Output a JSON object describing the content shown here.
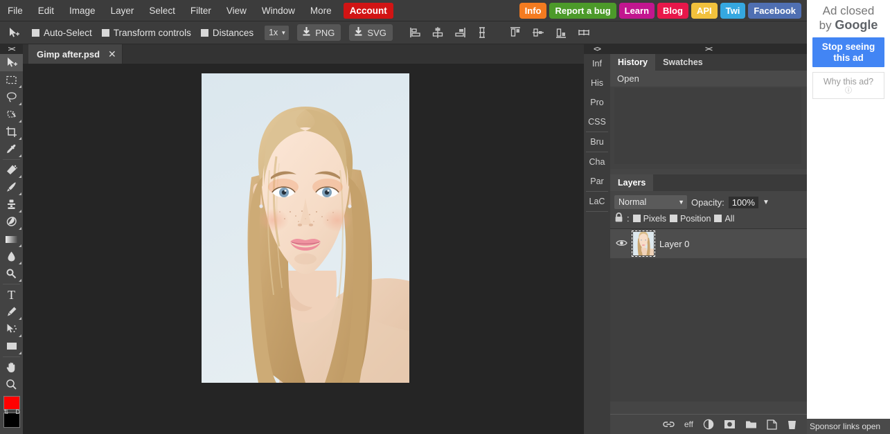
{
  "menubar": {
    "items": [
      "File",
      "Edit",
      "Image",
      "Layer",
      "Select",
      "Filter",
      "View",
      "Window",
      "More"
    ],
    "account_label": "Account",
    "right_buttons": [
      {
        "label": "Info",
        "color": "#f47b20"
      },
      {
        "label": "Report a bug",
        "color": "#4c9a2a"
      },
      {
        "label": "Learn",
        "color": "#c2168f"
      },
      {
        "label": "Blog",
        "color": "#e8174a"
      },
      {
        "label": "API",
        "color": "#f2c13c"
      },
      {
        "label": "Twi",
        "color": "#35a8e0"
      },
      {
        "label": "Facebook",
        "color": "#4f6fb2"
      }
    ]
  },
  "optionsbar": {
    "tool_icon": "move-tool-icon",
    "checkboxes": [
      {
        "label": "Auto-Select",
        "checked": false
      },
      {
        "label": "Transform controls",
        "checked": false
      },
      {
        "label": "Distances",
        "checked": false
      }
    ],
    "zoom_value": "1x",
    "download_buttons": [
      {
        "label": "PNG",
        "icon": "download-icon"
      },
      {
        "label": "SVG",
        "icon": "download-icon"
      }
    ],
    "align_icons_group1": [
      "align-left-icon",
      "align-center-horizontal-icon",
      "align-right-icon",
      "distribute-vertical-icon"
    ],
    "align_icons_group2": [
      "align-top-icon",
      "align-middle-vertical-icon",
      "align-bottom-icon",
      "distribute-horizontal-icon"
    ]
  },
  "toolbar": {
    "grip_label": "><",
    "tools": [
      {
        "name": "move-tool",
        "icon": "cursor-plus-icon",
        "active": true,
        "corner": false
      },
      {
        "name": "rectangular-marquee-tool",
        "icon": "marquee-rect-icon",
        "active": false,
        "corner": true
      },
      {
        "name": "lasso-tool",
        "icon": "lasso-icon",
        "active": false,
        "corner": true
      },
      {
        "name": "magic-wand-tool",
        "icon": "magic-wand-icon",
        "active": false,
        "corner": true
      },
      {
        "name": "crop-tool",
        "icon": "crop-icon",
        "active": false,
        "corner": true
      },
      {
        "name": "eyedropper-tool",
        "icon": "eyedropper-icon",
        "active": false,
        "corner": true
      },
      {
        "name": "healing-brush-tool",
        "icon": "healing-brush-icon",
        "active": false,
        "corner": true
      },
      {
        "name": "brush-tool",
        "icon": "brush-icon",
        "active": false,
        "corner": true
      },
      {
        "name": "clone-stamp-tool",
        "icon": "clone-stamp-icon",
        "active": false,
        "corner": true
      },
      {
        "name": "eraser-tool",
        "icon": "eraser-icon",
        "active": false,
        "corner": true
      },
      {
        "name": "gradient-tool",
        "icon": "gradient-icon",
        "active": false,
        "corner": true
      },
      {
        "name": "blur-tool",
        "icon": "blur-drop-icon",
        "active": false,
        "corner": true
      },
      {
        "name": "dodge-tool",
        "icon": "dodge-icon",
        "active": false,
        "corner": true
      },
      {
        "name": "type-tool",
        "icon": "text-t-icon",
        "active": false,
        "corner": false
      },
      {
        "name": "pen-tool",
        "icon": "pen-icon",
        "active": false,
        "corner": true
      },
      {
        "name": "path-select-tool",
        "icon": "path-select-icon",
        "active": false,
        "corner": true
      },
      {
        "name": "shape-tool",
        "icon": "rectangle-shape-icon",
        "active": false,
        "corner": true
      },
      {
        "name": "hand-tool",
        "icon": "hand-icon",
        "active": false,
        "corner": false
      },
      {
        "name": "zoom-tool",
        "icon": "magnifier-icon",
        "active": false,
        "corner": false
      }
    ],
    "foreground_color": "#ff0000",
    "background_color": "#000000",
    "swap_label": "⇅",
    "default_label": "D"
  },
  "document": {
    "tab_title": "Gimp after.psd",
    "close_label": "✕"
  },
  "panels": {
    "vertical_strip": {
      "grip_label": "<>",
      "tabs": [
        {
          "label": "Inf",
          "group": 1
        },
        {
          "label": "His",
          "group": 1
        },
        {
          "label": "Pro",
          "group": 1
        },
        {
          "label": "CSS",
          "group": 1
        },
        {
          "label": "Bru",
          "group": 2
        },
        {
          "label": "Cha",
          "group": 3
        },
        {
          "label": "Par",
          "group": 3
        },
        {
          "label": "LaC",
          "group": 4
        }
      ]
    },
    "grip_label": "><",
    "history": {
      "tabs": [
        {
          "label": "History",
          "active": true
        },
        {
          "label": "Swatches",
          "active": false
        }
      ],
      "items": [
        "Open"
      ]
    },
    "layers": {
      "tab_label": "Layers",
      "blend_mode": "Normal",
      "blend_caret": "▼",
      "opacity_label": "Opacity:",
      "opacity_value": "100%",
      "opacity_caret": "▼",
      "lock_icon": "lock-icon",
      "lock_colon": ":",
      "lock_options": [
        {
          "label": "Pixels",
          "checked": false
        },
        {
          "label": "Position",
          "checked": false
        },
        {
          "label": "All",
          "checked": false
        }
      ],
      "rows": [
        {
          "name": "Layer 0",
          "visible": true,
          "visibility_icon": "eye-icon",
          "thumbnail": "portrait-thumbnail"
        }
      ],
      "footer_icons": [
        {
          "name": "link-layers-icon",
          "label": "∞"
        },
        {
          "name": "layer-effects-icon",
          "label": "eff"
        },
        {
          "name": "adjustment-layer-icon",
          "label": ""
        },
        {
          "name": "layer-mask-icon",
          "label": ""
        },
        {
          "name": "new-group-icon",
          "label": ""
        },
        {
          "name": "new-layer-icon",
          "label": ""
        },
        {
          "name": "delete-layer-icon",
          "label": ""
        }
      ]
    }
  },
  "ad": {
    "line1": "Ad closed",
    "line2_prefix": "by ",
    "brand": "Google",
    "stop_button_line1": "Stop seeing",
    "stop_button_line2": "this ad",
    "why_label": "Why this ad?",
    "why_info_icon": "info-circle-icon",
    "sponsor_text": "Sponsor links open"
  },
  "colors": {
    "menubar_bg": "#3c3c3c",
    "panel_bg": "#454545",
    "canvas_bg": "#252525",
    "accent_red": "#d11414",
    "ad_blue": "#4285f4"
  }
}
